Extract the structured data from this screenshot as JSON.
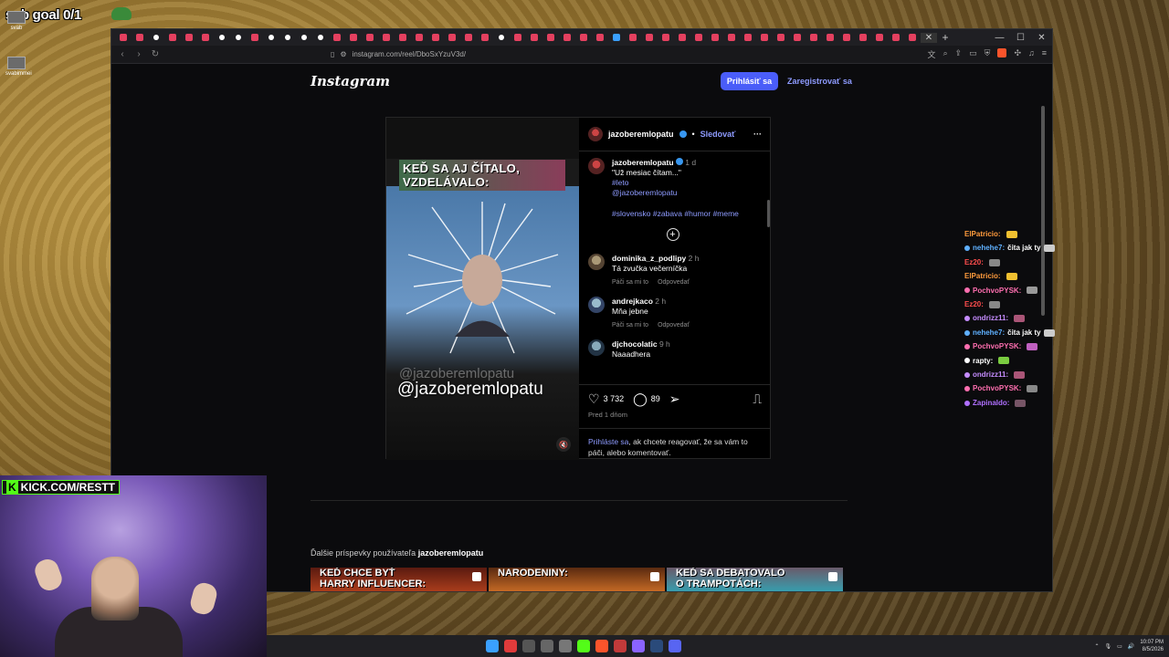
{
  "overlay": {
    "sub_goal": "sub goal 0/1",
    "desktop_icons": [
      {
        "label": "svab"
      },
      {
        "label": "svabimmei"
      }
    ],
    "kick_label": "KICK.COM/RESTT",
    "kick_letter": "K"
  },
  "browser": {
    "url": "instagram.com/reel/DboSxYzuV3d/",
    "window_controls": [
      "—",
      "☐",
      "✕"
    ],
    "tab_new": "+",
    "tab_close": "✕"
  },
  "instagram": {
    "logo": "Instagram",
    "login_button": "Prihlásiť sa",
    "register_link": "Zaregistrovať sa",
    "post": {
      "overlay_caption_line1": "KEĎ SA AJ ČÍTALO,",
      "overlay_caption_line2": "VZDELÁVALO:",
      "watermark_ghost": "@jazoberemlopatu",
      "watermark": "@jazoberemlopatu",
      "author": "jazoberemlopatu",
      "follow": "Sledovať",
      "more": "···",
      "caption": {
        "user": "jazoberemlopatu",
        "time": "1 d",
        "text": "\"Už mesiac čítam...\"",
        "tag_line1": "#leto",
        "mention": "@jazoberemlopatu",
        "hashtags": "#slovensko #zabava #humor #meme"
      },
      "comments": [
        {
          "user": "dominika_z_podlipy",
          "time": "2 h",
          "text": "Tá zvučka večerníčka",
          "like": "Páči sa mi to",
          "reply": "Odpovedať"
        },
        {
          "user": "andrejkaco",
          "time": "2 h",
          "text": "Mňa jebne",
          "like": "Páči sa mi to",
          "reply": "Odpovedať"
        },
        {
          "user": "djchocolatic",
          "time": "9 h",
          "text": "Naaadhera",
          "like": "",
          "reply": ""
        }
      ],
      "likes": "3 732",
      "comment_count": "89",
      "posted_ago": "Pred 1 dňom",
      "login_hint_link": "Prihláste sa",
      "login_hint_text": ", ak chcete reagovať, že sa vám to páči, alebo komentovať."
    },
    "more_posts_prefix": "Ďalšie príspevky používateľa",
    "more_posts_user": "jazoberemlopatu",
    "thumbs": [
      {
        "text1": "KEĎ CHCE BYŤ",
        "text2": "HARRY INFLUENCER:"
      },
      {
        "text1": "NARODENINY:",
        "text2": ""
      },
      {
        "text1": "KEĎ SA DEBATOVALO",
        "text2": "O TRAMPOTÁCH:"
      }
    ]
  },
  "chat": [
    {
      "user": "ElPatricio:",
      "color": "#ff9b3d",
      "msg": ""
    },
    {
      "user": "nehehe7:",
      "color": "#5fb0ff",
      "msg": "čita jak ty"
    },
    {
      "user": "Ez20:",
      "color": "#ff4d4d",
      "msg": ""
    },
    {
      "user": "ElPatricio:",
      "color": "#ff9b3d",
      "msg": ""
    },
    {
      "user": "PochvoPYSK:",
      "color": "#ff6fb0",
      "msg": ""
    },
    {
      "user": "Ez20:",
      "color": "#ff4d4d",
      "msg": ""
    },
    {
      "user": "ondrizz11:",
      "color": "#c58cff",
      "msg": ""
    },
    {
      "user": "nehehe7:",
      "color": "#5fb0ff",
      "msg": "čita jak ty"
    },
    {
      "user": "PochvoPYSK:",
      "color": "#ff6fb0",
      "msg": ""
    },
    {
      "user": "rapty:",
      "color": "#ffffff",
      "msg": ""
    },
    {
      "user": "ondrizz11:",
      "color": "#c58cff",
      "msg": ""
    },
    {
      "user": "PochvoPYSK:",
      "color": "#ff6fb0",
      "msg": ""
    },
    {
      "user": "Zapinaldo:",
      "color": "#b070ff",
      "msg": ""
    }
  ],
  "taskbar": {
    "time": "10:07 PM",
    "date": "8/5/2026"
  },
  "colors": {
    "ig_blue": "#4a5df9",
    "ig_link": "#8e9bff",
    "kick_green": "#53fc18"
  }
}
